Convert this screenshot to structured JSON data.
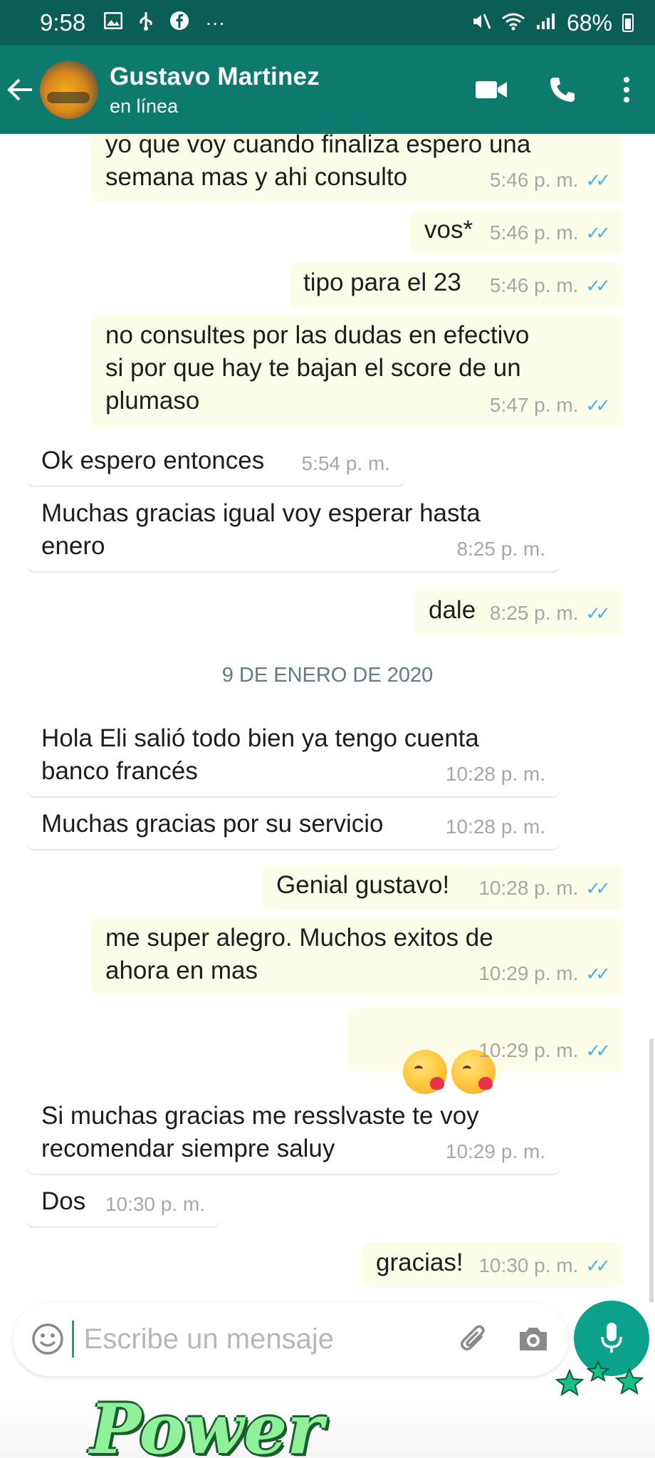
{
  "status_bar": {
    "time": "9:58",
    "notification_icons": [
      "image-icon",
      "usb-icon",
      "facebook-icon",
      "more-icon"
    ],
    "more": "···",
    "battery": "68%"
  },
  "header": {
    "contact_name": "Gustavo Martinez",
    "contact_status": "en línea"
  },
  "messages": [
    {
      "dir": "out",
      "text": "yo que voy cuando finaliza espero una\nsemana mas y ahi consulto",
      "time": "5:46 p. m.",
      "read": true
    },
    {
      "dir": "out",
      "text": "vos*",
      "time": "5:46 p. m.",
      "read": true
    },
    {
      "dir": "out",
      "text": "tipo para el 23",
      "time": "5:46 p. m.",
      "read": true
    },
    {
      "dir": "out",
      "text": "no consultes por las dudas en efectivo\nsi por que hay te bajan el score de un\nplumaso",
      "time": "5:47 p. m.",
      "read": true
    },
    {
      "dir": "in",
      "text": "Ok espero entonces",
      "time": "5:54 p. m."
    },
    {
      "dir": "in",
      "text": "Muchas gracias igual voy esperar hasta\nenero",
      "time": "8:25 p. m."
    },
    {
      "dir": "out",
      "text": "dale",
      "time": "8:25 p. m.",
      "read": true
    },
    {
      "dir": "in",
      "text": "Hola Eli salió todo bien ya tengo cuenta\nbanco francés",
      "time": "10:28 p. m."
    },
    {
      "dir": "in",
      "text": "Muchas gracias por su servicio",
      "time": "10:28 p. m."
    },
    {
      "dir": "out",
      "text": "Genial gustavo!",
      "time": "10:28 p. m.",
      "read": true
    },
    {
      "dir": "out",
      "text": "me super alegro. Muchos exitos de\nahora en mas",
      "time": "10:29 p. m.",
      "read": true
    },
    {
      "dir": "out",
      "emoji": [
        "kissing-face-with-heart",
        "kissing-face-with-heart"
      ],
      "time": "10:29 p. m.",
      "read": true
    },
    {
      "dir": "in",
      "text": "Si muchas gracias me resslvaste te voy\nrecomendar siempre saluy",
      "time": "10:29 p. m."
    },
    {
      "dir": "in",
      "text": "Dos",
      "time": "10:30 p. m."
    },
    {
      "dir": "out",
      "text": "gracias!",
      "time": "10:30 p. m.",
      "read": true
    }
  ],
  "date_separator": "9 DE ENERO DE 2020",
  "composer": {
    "placeholder": "Escribe un mensaje"
  },
  "watermark": "Power",
  "colors": {
    "status_bar": "#0b5e54",
    "header": "#0c7a6c",
    "outgoing_bubble": "#fdfeea",
    "incoming_bubble": "#ffffff",
    "read_ticks": "#4fb3ea",
    "mic_button": "#0ba18b",
    "watermark_fill": "#8ff29a"
  }
}
